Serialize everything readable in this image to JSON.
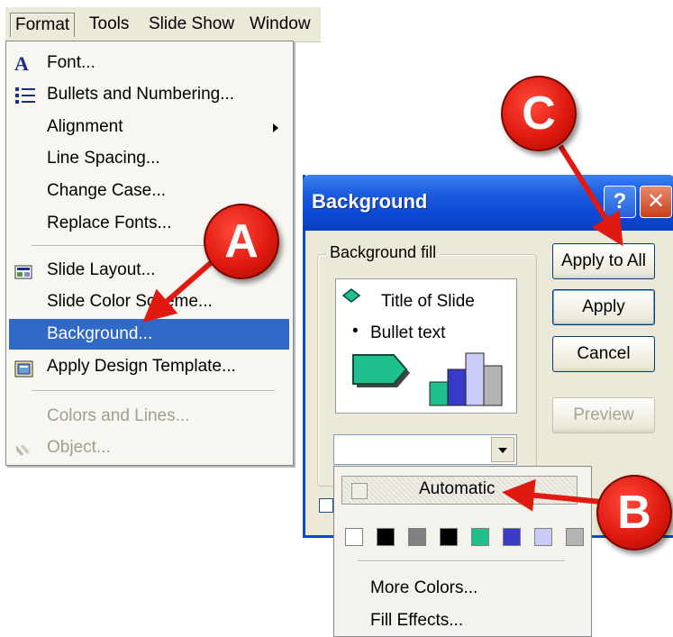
{
  "menubar": {
    "items": [
      {
        "label": "Format"
      },
      {
        "label": "Tools"
      },
      {
        "label": "Slide Show"
      },
      {
        "label": "Window"
      }
    ]
  },
  "format_menu": {
    "items": [
      {
        "label": "Font...",
        "icon": "font-icon"
      },
      {
        "label": "Bullets and Numbering...",
        "icon": "bullets-icon"
      },
      {
        "label": "Alignment",
        "submenu": true
      },
      {
        "label": "Line Spacing..."
      },
      {
        "label": "Change Case..."
      },
      {
        "label": "Replace Fonts..."
      },
      {
        "label": "Slide Layout...",
        "icon": "slide-layout-icon"
      },
      {
        "label": "Slide Color Scheme..."
      },
      {
        "label": "Background...",
        "highlighted": true
      },
      {
        "label": "Apply Design Template...",
        "icon": "design-template-icon"
      },
      {
        "label": "Colors and Lines...",
        "disabled": true
      },
      {
        "label": "Object...",
        "disabled": true,
        "icon": "object-icon"
      }
    ]
  },
  "dialog": {
    "title": "Background",
    "help_label": "?",
    "close_label": "✕",
    "group_label": "Background fill",
    "preview": {
      "title": "Title of Slide",
      "bullet": "Bullet text",
      "bullet_marker": "•"
    },
    "buttons": {
      "apply_all": "Apply to All",
      "apply": "Apply",
      "cancel": "Cancel",
      "preview": "Preview"
    }
  },
  "dropdown": {
    "automatic": "Automatic",
    "swatches": [
      "#ffffff",
      "#000000",
      "#808080",
      "#000000",
      "#1fbf8f",
      "#3a3ac8",
      "#c8ccf6",
      "#b4b4b4"
    ],
    "more_colors": "More Colors...",
    "fill_effects": "Fill Effects..."
  },
  "callouts": {
    "a": "A",
    "b": "B",
    "c": "C"
  },
  "colors": {
    "highlight": "#3169c6",
    "titlebar": "#0a48d6",
    "callout": "#e01a10"
  }
}
